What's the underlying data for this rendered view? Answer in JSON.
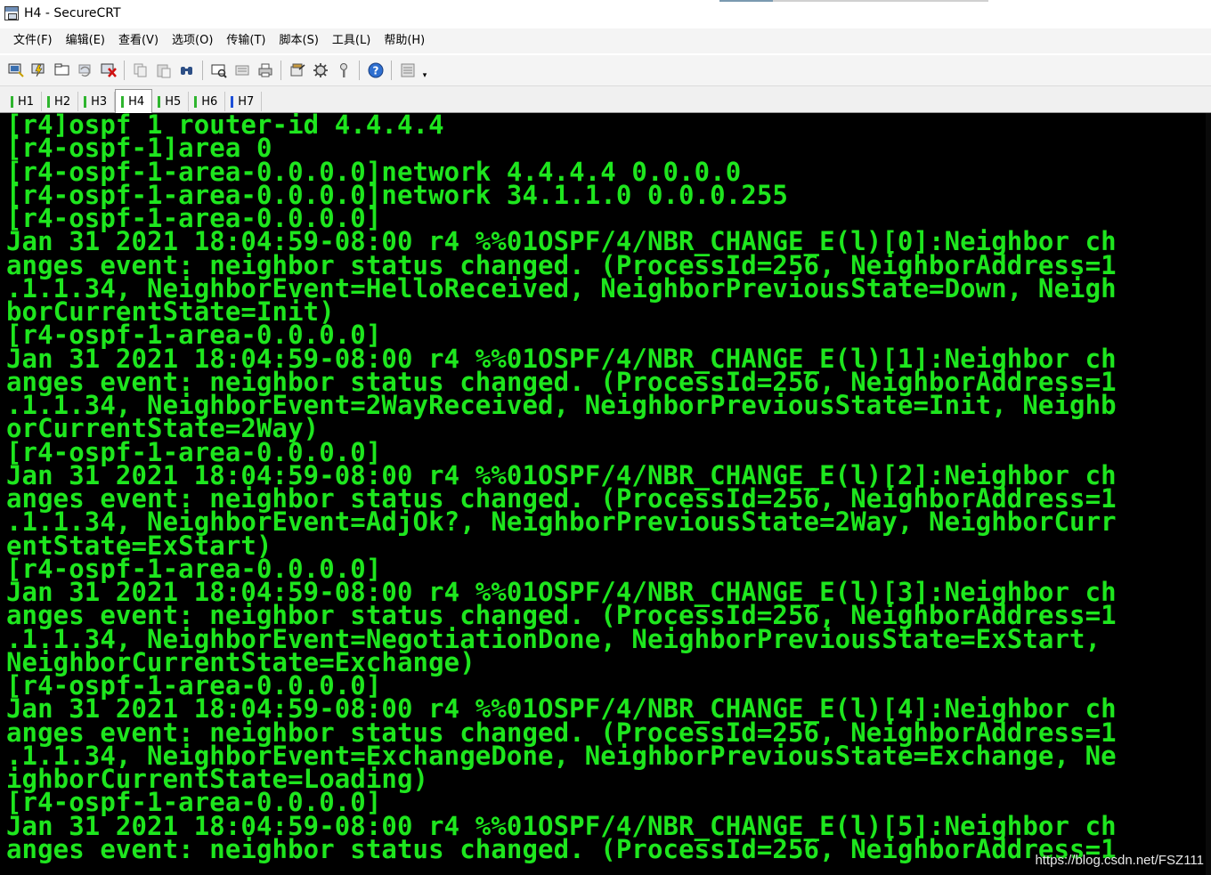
{
  "window": {
    "title": "H4 - SecureCRT"
  },
  "menu": [
    "文件(F)",
    "编辑(E)",
    "查看(V)",
    "选项(O)",
    "传输(T)",
    "脚本(S)",
    "工具(L)",
    "帮助(H)"
  ],
  "toolbar": {
    "buttons": [
      "connect-icon",
      "quick-connect-icon",
      "connect-tab-icon",
      "reconnect-icon",
      "disconnect-icon",
      "copy-icon",
      "paste-icon",
      "find-icon",
      "print-preview-icon",
      "print-setup-icon",
      "print-icon",
      "session-options-icon",
      "global-options-icon",
      "keymap-icon",
      "help-icon",
      "session-manager-icon"
    ]
  },
  "tabs": [
    {
      "label": "H1",
      "active": false,
      "status_color": "#2fb52f"
    },
    {
      "label": "H2",
      "active": false,
      "status_color": "#2fb52f"
    },
    {
      "label": "H3",
      "active": false,
      "status_color": "#2fb52f"
    },
    {
      "label": "H4",
      "active": true,
      "status_color": "#2fb52f"
    },
    {
      "label": "H5",
      "active": false,
      "status_color": "#2fb52f"
    },
    {
      "label": "H6",
      "active": false,
      "status_color": "#2fb52f"
    },
    {
      "label": "H7",
      "active": false,
      "status_color": "#1e50d8"
    }
  ],
  "terminal": {
    "text_color": "#1ee61e",
    "background": "#000000",
    "lines": [
      "[r4]ospf 1 router-id 4.4.4.4",
      "[r4-ospf-1]area 0",
      "[r4-ospf-1-area-0.0.0.0]network 4.4.4.4 0.0.0.0",
      "[r4-ospf-1-area-0.0.0.0]network 34.1.1.0 0.0.0.255",
      "[r4-ospf-1-area-0.0.0.0]",
      "Jan 31 2021 18:04:59-08:00 r4 %%01OSPF/4/NBR_CHANGE_E(l)[0]:Neighbor ch",
      "anges event: neighbor status changed. (ProcessId=256, NeighborAddress=1",
      ".1.1.34, NeighborEvent=HelloReceived, NeighborPreviousState=Down, Neigh",
      "borCurrentState=Init)",
      "[r4-ospf-1-area-0.0.0.0]",
      "Jan 31 2021 18:04:59-08:00 r4 %%01OSPF/4/NBR_CHANGE_E(l)[1]:Neighbor ch",
      "anges event: neighbor status changed. (ProcessId=256, NeighborAddress=1",
      ".1.1.34, NeighborEvent=2WayReceived, NeighborPreviousState=Init, Neighb",
      "orCurrentState=2Way)",
      "[r4-ospf-1-area-0.0.0.0]",
      "Jan 31 2021 18:04:59-08:00 r4 %%01OSPF/4/NBR_CHANGE_E(l)[2]:Neighbor ch",
      "anges event: neighbor status changed. (ProcessId=256, NeighborAddress=1",
      ".1.1.34, NeighborEvent=AdjOk?, NeighborPreviousState=2Way, NeighborCurr",
      "entState=ExStart)",
      "[r4-ospf-1-area-0.0.0.0]",
      "Jan 31 2021 18:04:59-08:00 r4 %%01OSPF/4/NBR_CHANGE_E(l)[3]:Neighbor ch",
      "anges event: neighbor status changed. (ProcessId=256, NeighborAddress=1",
      ".1.1.34, NeighborEvent=NegotiationDone, NeighborPreviousState=ExStart,",
      "NeighborCurrentState=Exchange)",
      "[r4-ospf-1-area-0.0.0.0]",
      "Jan 31 2021 18:04:59-08:00 r4 %%01OSPF/4/NBR_CHANGE_E(l)[4]:Neighbor ch",
      "anges event: neighbor status changed. (ProcessId=256, NeighborAddress=1",
      ".1.1.34, NeighborEvent=ExchangeDone, NeighborPreviousState=Exchange, Ne",
      "ighborCurrentState=Loading)",
      "[r4-ospf-1-area-0.0.0.0]",
      "Jan 31 2021 18:04:59-08:00 r4 %%01OSPF/4/NBR_CHANGE_E(l)[5]:Neighbor ch",
      "anges event: neighbor status changed. (ProcessId=256, NeighborAddress=1"
    ]
  },
  "watermark": "https://blog.csdn.net/FSZ111"
}
